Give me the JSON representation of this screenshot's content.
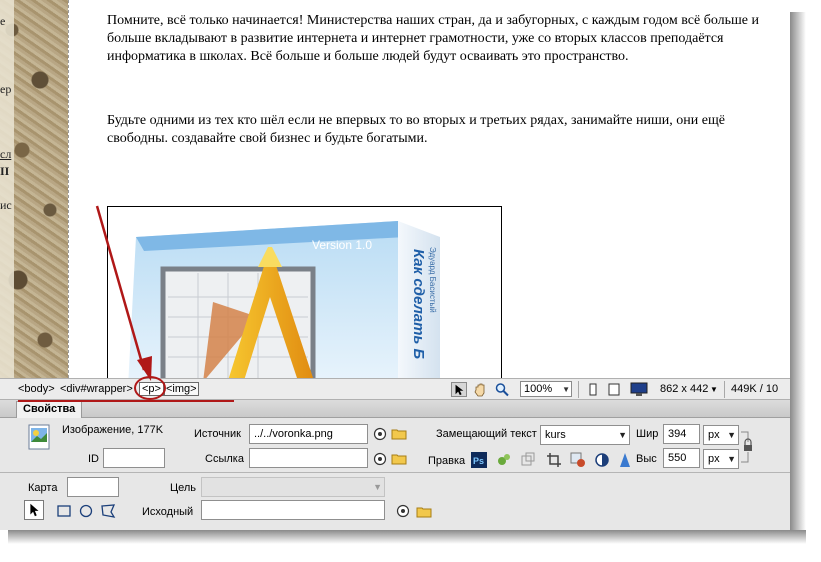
{
  "content": {
    "paragraph1": "Помните, всё только начинается! Министерства наших стран, да и забугорных, с каждым годом всё больше и больше вкладывают в развитие интернета и интернет грамотности, уже со вторых классов преподаётся информатика в школах. Всё больше и больше людей будут осваивать это пространство.",
    "paragraph2": "Будьте одними из тех кто шёл если не впервых то во вторых и третьих рядах, занимайте ниши, они ещё свободны. создавайте свой бизнес и будьте богатыми.",
    "box_version": "Version 1.0",
    "box_title": "Как сделать Б",
    "box_subtitle": "Эдуард Басистый",
    "left_edge_letters": [
      "е",
      "ер",
      "сл",
      "ІІ",
      "ис"
    ]
  },
  "tag_selector": {
    "tags": [
      "<body>",
      "<div#wrapper>",
      "<p>",
      "<img>"
    ],
    "selected": "<p>"
  },
  "status": {
    "zoom": "100%",
    "dimensions": "862 x 442",
    "filesize": "449K / 10"
  },
  "properties": {
    "tab_label": "Свойства",
    "type_label": "Изображение, 177K",
    "id_label": "ID",
    "id_value": "",
    "src_label": "Источник",
    "src_value": "../../voronka.png",
    "link_label": "Ссылка",
    "link_value": "",
    "alt_label": "Замещающий текст",
    "alt_value": "kurs",
    "edit_label": "Правка",
    "width_label": "Шир",
    "width_value": "394",
    "width_unit": "px",
    "height_label": "Выс",
    "height_value": "550",
    "height_unit": "px",
    "map_label": "Карта",
    "map_value": "",
    "target_label": "Цель",
    "target_value": "",
    "original_label": "Исходный",
    "original_value": ""
  },
  "colors": {
    "annotation": "#b01818",
    "panel_bg": "#e7e7e7"
  }
}
